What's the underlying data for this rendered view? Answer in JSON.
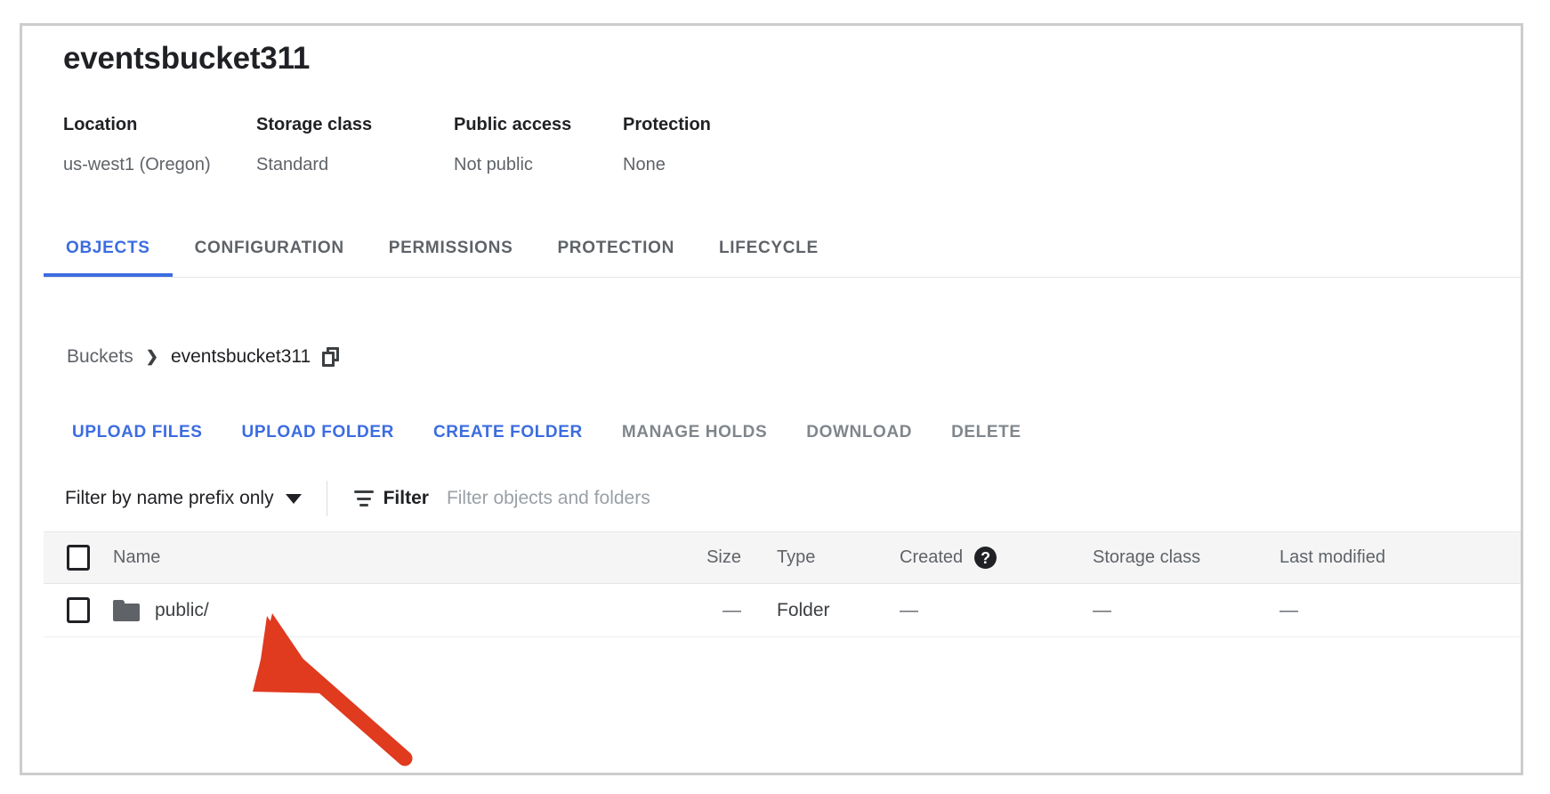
{
  "bucket": {
    "title": "eventsbucket311",
    "meta": [
      {
        "label": "Location",
        "value": "us-west1 (Oregon)"
      },
      {
        "label": "Storage class",
        "value": "Standard"
      },
      {
        "label": "Public access",
        "value": "Not public"
      },
      {
        "label": "Protection",
        "value": "None"
      }
    ]
  },
  "tabs": [
    {
      "label": "OBJECTS",
      "active": true
    },
    {
      "label": "CONFIGURATION",
      "active": false
    },
    {
      "label": "PERMISSIONS",
      "active": false
    },
    {
      "label": "PROTECTION",
      "active": false
    },
    {
      "label": "LIFECYCLE",
      "active": false
    }
  ],
  "breadcrumb": {
    "root": "Buckets",
    "separator": "❯",
    "current": "eventsbucket311"
  },
  "actions": [
    {
      "label": "UPLOAD FILES",
      "enabled": true
    },
    {
      "label": "UPLOAD FOLDER",
      "enabled": true
    },
    {
      "label": "CREATE FOLDER",
      "enabled": true
    },
    {
      "label": "MANAGE HOLDS",
      "enabled": false
    },
    {
      "label": "DOWNLOAD",
      "enabled": false
    },
    {
      "label": "DELETE",
      "enabled": false
    }
  ],
  "filter": {
    "prefix_mode": "Filter by name prefix only",
    "filter_label": "Filter",
    "placeholder": "Filter objects and folders",
    "value": ""
  },
  "table": {
    "columns": [
      "Name",
      "Size",
      "Type",
      "Created",
      "Storage class",
      "Last modified"
    ],
    "rows": [
      {
        "name": "public/",
        "size": "—",
        "type": "Folder",
        "created": "—",
        "storage_class": "—",
        "last_modified": "—"
      }
    ]
  },
  "annotation": {
    "arrow_color": "#e03a1f",
    "points_to": "public/"
  },
  "colors": {
    "accent": "#3c6ce0",
    "text_primary": "#202124",
    "text_secondary": "#5f6368",
    "disabled": "#80868b",
    "border": "#e4e6e8",
    "panel_border": "#cccccc"
  }
}
